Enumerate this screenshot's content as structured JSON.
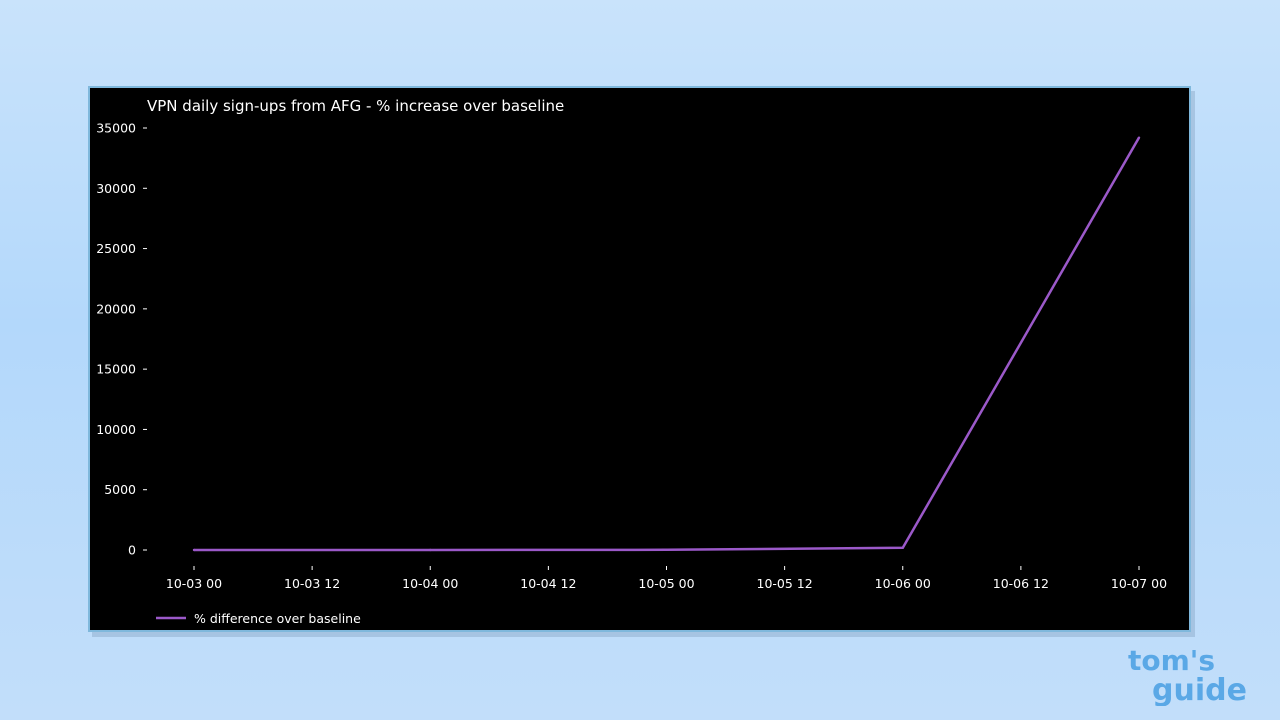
{
  "brand": {
    "logo_line1": "tom's",
    "logo_line2": "guide",
    "color": "#5aa8e6"
  },
  "chart_data": {
    "type": "line",
    "title": "VPN daily sign-ups from AFG - % increase over baseline",
    "xlabel": "",
    "ylabel": "",
    "x_ticks": [
      "10-03 00",
      "10-03 12",
      "10-04 00",
      "10-04 12",
      "10-05 00",
      "10-05 12",
      "10-06 00",
      "10-06 12",
      "10-07 00"
    ],
    "y_ticks": [
      "0",
      "5000",
      "10000",
      "15000",
      "20000",
      "25000",
      "30000",
      "35000"
    ],
    "ylim": [
      -1500,
      36000
    ],
    "xlim": [
      "2021-10-02T21:00",
      "2021-10-07T03:00"
    ],
    "grid": false,
    "legend_position": "bottom-left",
    "series": [
      {
        "name": "% difference over baseline",
        "color": "#9b59c9",
        "x": [
          "2021-10-03T00:00",
          "2021-10-04T00:00",
          "2021-10-05T00:00",
          "2021-10-06T00:00",
          "2021-10-07T00:00"
        ],
        "y": [
          0,
          0,
          20,
          180,
          34200
        ]
      }
    ]
  }
}
